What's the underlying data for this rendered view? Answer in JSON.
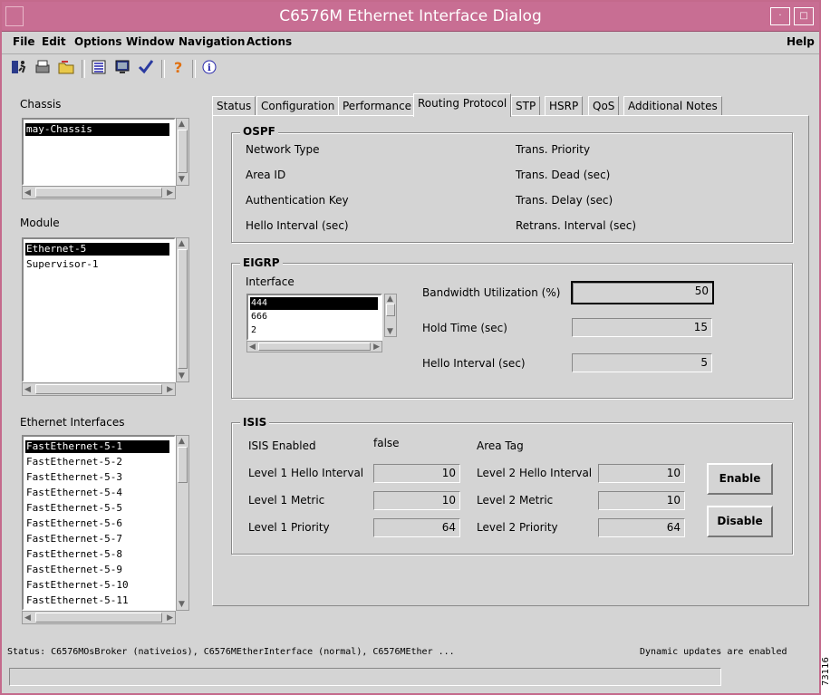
{
  "window": {
    "title": "C6576M Ethernet Interface Dialog"
  },
  "menu": {
    "file": "File",
    "edit": "Edit",
    "options": "Options",
    "window": "Window",
    "navigation": "Navigation",
    "actions": "Actions",
    "help": "Help"
  },
  "toolbar": {
    "icons": [
      "exit-icon",
      "print-icon",
      "open-folder-icon",
      "list-icon",
      "monitor-icon",
      "check-icon",
      "help-icon",
      "info-icon"
    ]
  },
  "sidebar": {
    "chassis_label": "Chassis",
    "chassis_items": [
      "may-Chassis"
    ],
    "module_label": "Module",
    "module_items": [
      "Ethernet-5",
      "Supervisor-1"
    ],
    "eth_label": "Ethernet Interfaces",
    "eth_items": [
      "FastEthernet-5-1",
      "FastEthernet-5-2",
      "FastEthernet-5-3",
      "FastEthernet-5-4",
      "FastEthernet-5-5",
      "FastEthernet-5-6",
      "FastEthernet-5-7",
      "FastEthernet-5-8",
      "FastEthernet-5-9",
      "FastEthernet-5-10",
      "FastEthernet-5-11"
    ]
  },
  "tabs": [
    "Status",
    "Configuration",
    "Performance",
    "Routing Protocol",
    "STP",
    "HSRP",
    "QoS",
    "Additional Notes"
  ],
  "active_tab": "Routing Protocol",
  "ospf": {
    "title": "OSPF",
    "network_type": "Network Type",
    "area_id": "Area ID",
    "auth_key": "Authentication Key",
    "hello_interval": "Hello Interval (sec)",
    "trans_priority": "Trans. Priority",
    "trans_dead": "Trans. Dead (sec)",
    "trans_delay": "Trans. Delay (sec)",
    "retrans_interval": "Retrans. Interval (sec)"
  },
  "eigrp": {
    "title": "EIGRP",
    "interface_label": "Interface",
    "interfaces": [
      "444",
      "666",
      "2"
    ],
    "bandwidth_label": "Bandwidth Utilization (%)",
    "bandwidth_value": "50",
    "hold_label": "Hold Time (sec)",
    "hold_value": "15",
    "hello_label": "Hello Interval (sec)",
    "hello_value": "5"
  },
  "isis": {
    "title": "ISIS",
    "enabled_label": "ISIS Enabled",
    "enabled_value": "false",
    "area_tag_label": "Area Tag",
    "l1_hello_label": "Level 1 Hello Interval",
    "l1_hello_value": "10",
    "l1_metric_label": "Level 1 Metric",
    "l1_metric_value": "10",
    "l1_priority_label": "Level 1 Priority",
    "l1_priority_value": "64",
    "l2_hello_label": "Level 2 Hello Interval",
    "l2_hello_value": "10",
    "l2_metric_label": "Level 2 Metric",
    "l2_metric_value": "10",
    "l2_priority_label": "Level 2 Priority",
    "l2_priority_value": "64",
    "enable_button": "Enable",
    "disable_button": "Disable"
  },
  "status": {
    "text": "Status: C6576MOsBroker (nativeios), C6576MEtherInterface (normal), C6576MEther ...",
    "updates": "Dynamic updates are enabled"
  },
  "side_id": "73116"
}
